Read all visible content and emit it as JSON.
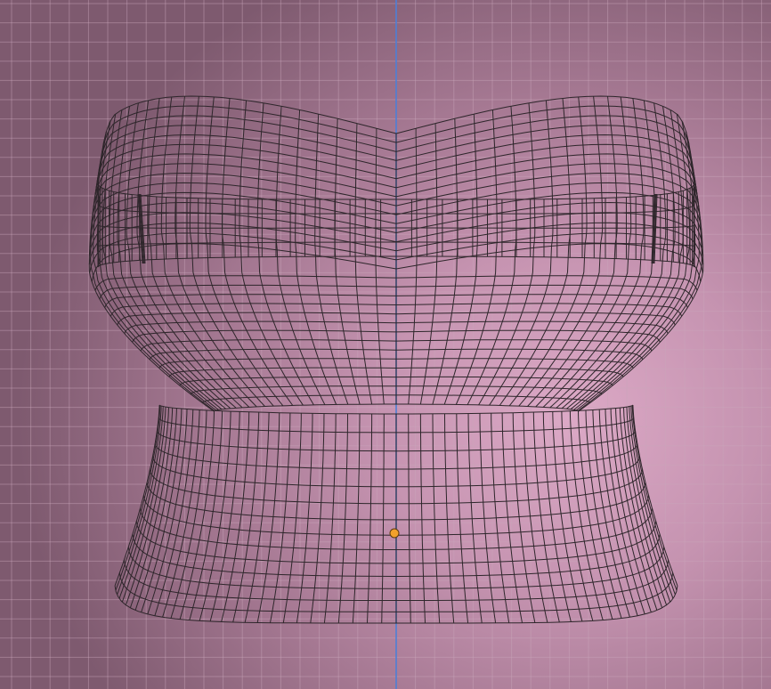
{
  "viewport": {
    "colors": {
      "background_center": "#dca9c6",
      "background_edge": "#7e5a6f",
      "grid_line": "#c9a6bb",
      "axis_z": "#4d7fd6",
      "wire": "#2e262b",
      "origin_dot": "#f2a12b"
    },
    "object": {
      "type": "wireframe-mesh",
      "description_icon": "corset-top-mesh"
    }
  }
}
